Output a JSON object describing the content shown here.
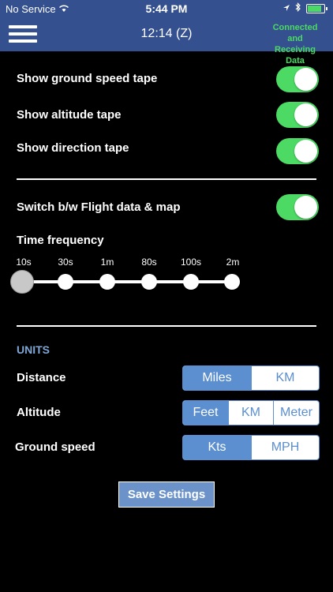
{
  "status_bar": {
    "carrier": "No Service",
    "time": "5:44 PM"
  },
  "navbar": {
    "title": "12:14 (Z)",
    "status_line1": "Connected and",
    "status_line2": "Receiving Data"
  },
  "toggles": [
    {
      "label": "Show ground speed tape",
      "on": true
    },
    {
      "label": "Show altitude tape",
      "on": true
    },
    {
      "label": "Show direction tape",
      "on": true
    },
    {
      "label": "Switch b/w Flight data & map",
      "on": true
    }
  ],
  "time_frequency": {
    "label": "Time frequency",
    "options": [
      "10s",
      "30s",
      "1m",
      "80s",
      "100s",
      "2m"
    ],
    "selected": "10s"
  },
  "units": {
    "title": "UNITS",
    "distance": {
      "label": "Distance",
      "options": [
        "Miles",
        "KM"
      ],
      "selected": "Miles"
    },
    "altitude": {
      "label": "Altitude",
      "options": [
        "Feet",
        "KM",
        "Meter"
      ],
      "selected": "Feet"
    },
    "ground_speed": {
      "label": "Ground speed",
      "options": [
        "Kts",
        "MPH"
      ],
      "selected": "Kts"
    }
  },
  "save_button": "Save Settings",
  "colors": {
    "nav_blue": "#34508f",
    "toggle_green": "#4cd964",
    "segment_blue": "#5b8fcf",
    "connected_green": "#4cd964"
  }
}
